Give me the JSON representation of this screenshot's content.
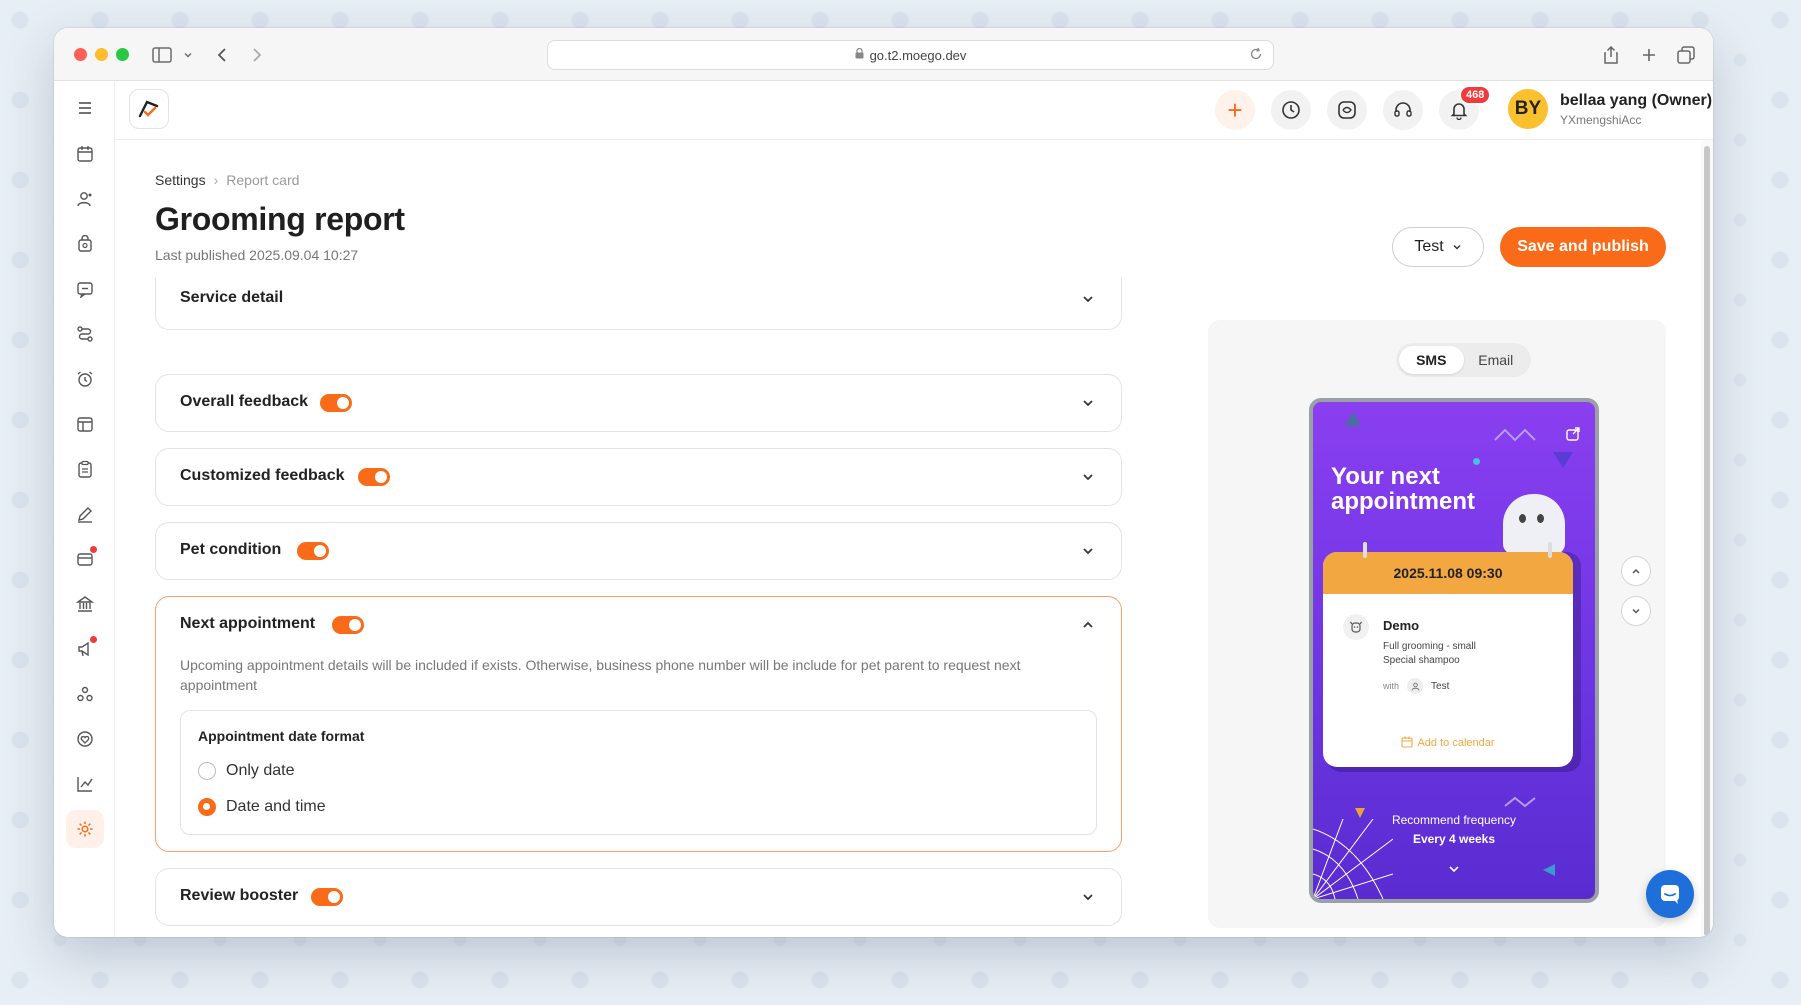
{
  "browser": {
    "url": "go.t2.moego.dev"
  },
  "header": {
    "notification_count": "468",
    "user": {
      "initials": "BY",
      "name": "bellaa yang (Owner)",
      "account": "YXmengshiAcc"
    }
  },
  "breadcrumb": {
    "root": "Settings",
    "separator": "›",
    "current": "Report card"
  },
  "page": {
    "title": "Grooming report",
    "last_published": "Last published 2025.09.04 10:27",
    "test_label": "Test",
    "publish_label": "Save and publish"
  },
  "sections": {
    "service_detail": "Service detail",
    "overall_feedback": "Overall feedback",
    "customized_feedback": "Customized feedback",
    "pet_condition": "Pet condition",
    "next_appointment": "Next appointment",
    "review_booster": "Review booster"
  },
  "next_appointment": {
    "description": "Upcoming appointment details will be included if exists. Otherwise, business phone number will be include for pet parent to request next appointment",
    "format_title": "Appointment date format",
    "options": [
      "Only date",
      "Date and time"
    ],
    "selected": "Date and time"
  },
  "preview": {
    "tabs": [
      "SMS",
      "Email"
    ],
    "active_tab": "SMS",
    "card_title": "Your next appointment",
    "datetime": "2025.11.08 09:30",
    "pet_name": "Demo",
    "service_1": "Full grooming - small",
    "service_2": "Special shampoo",
    "with_label": "with",
    "staff": "Test",
    "add_to_calendar": "Add to calendar",
    "frequency_label": "Recommend frequency",
    "frequency_value": "Every 4 weeks"
  },
  "colors": {
    "accent": "#f96b18",
    "preview_bg": "#7c3aed",
    "card_header": "#f2a741",
    "chat": "#1e6fd9"
  }
}
